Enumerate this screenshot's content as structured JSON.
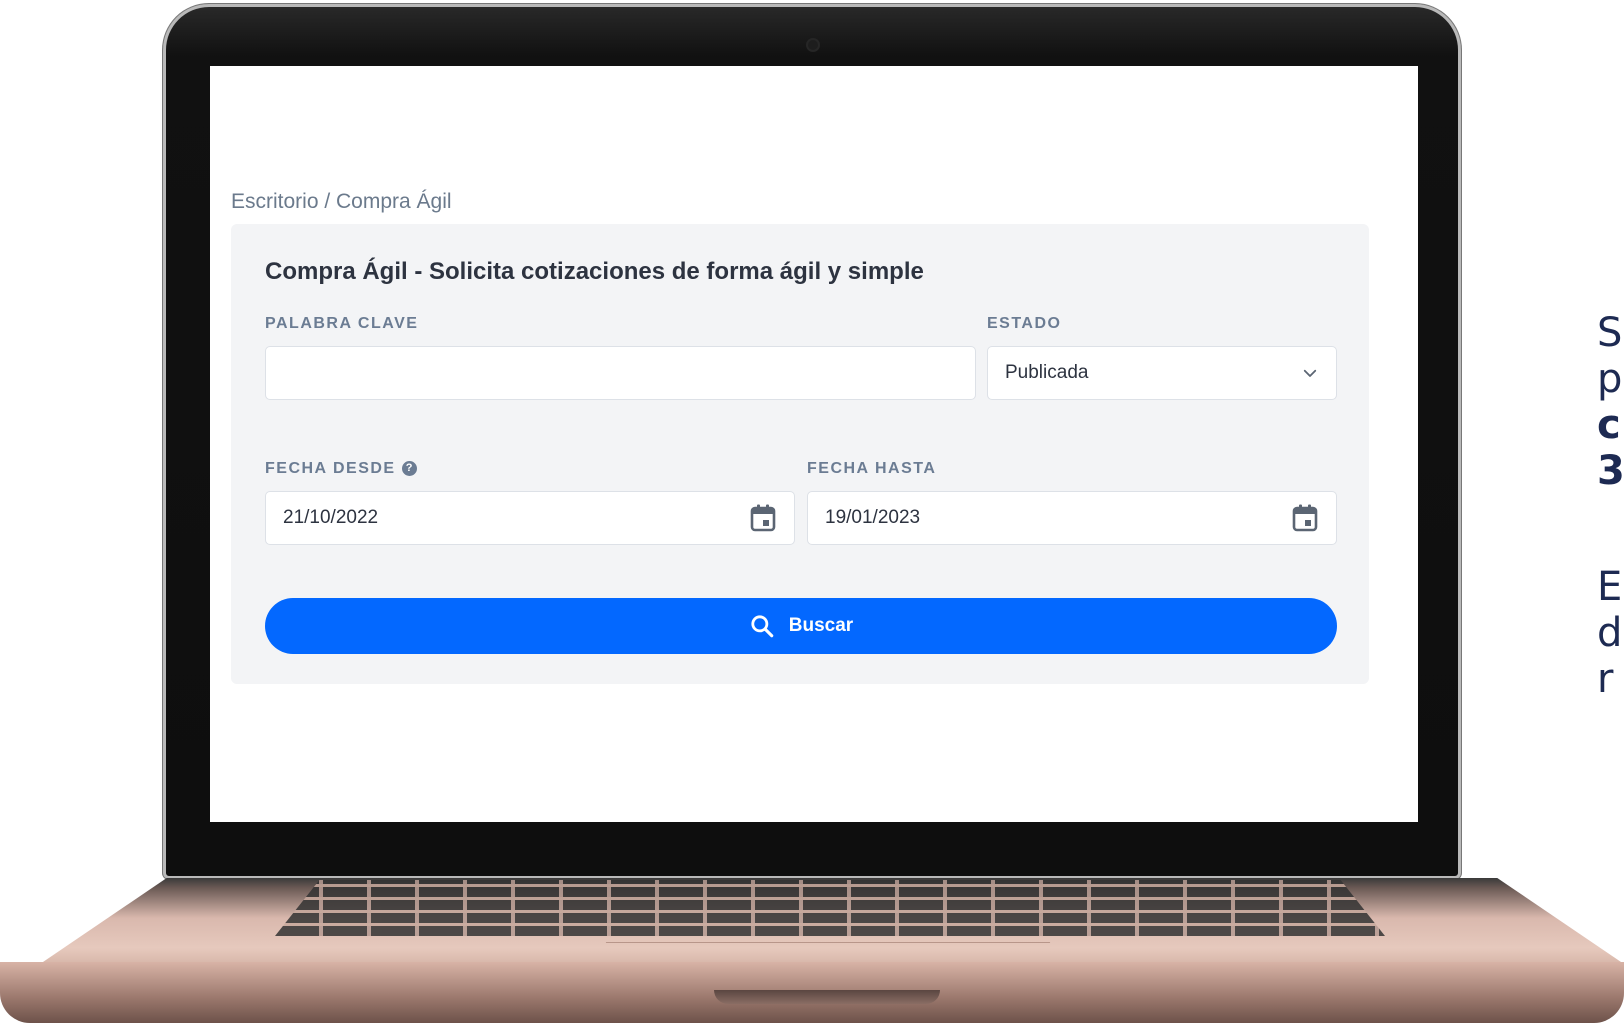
{
  "breadcrumb": "Escritorio / Compra Ágil",
  "panel": {
    "title": "Compra Ágil - Solicita cotizaciones de forma ágil y simple"
  },
  "fields": {
    "keyword": {
      "label": "PALABRA CLAVE",
      "value": ""
    },
    "status": {
      "label": "ESTADO",
      "value": "Publicada"
    },
    "date_from": {
      "label": "FECHA DESDE",
      "value": "21/10/2022"
    },
    "date_to": {
      "label": "FECHA HASTA",
      "value": "19/01/2023"
    }
  },
  "search_button": {
    "label": "Buscar"
  },
  "side_text": {
    "line1": "S",
    "line2": "p",
    "line3": "c",
    "line4": "3",
    "line5": "E",
    "line6": "d",
    "line7": "r"
  },
  "colors": {
    "primary": "#0368ff",
    "panel_bg": "#f3f4f6",
    "label": "#6b7c93",
    "title": "#2d3340",
    "side_text": "#1d2a52"
  }
}
